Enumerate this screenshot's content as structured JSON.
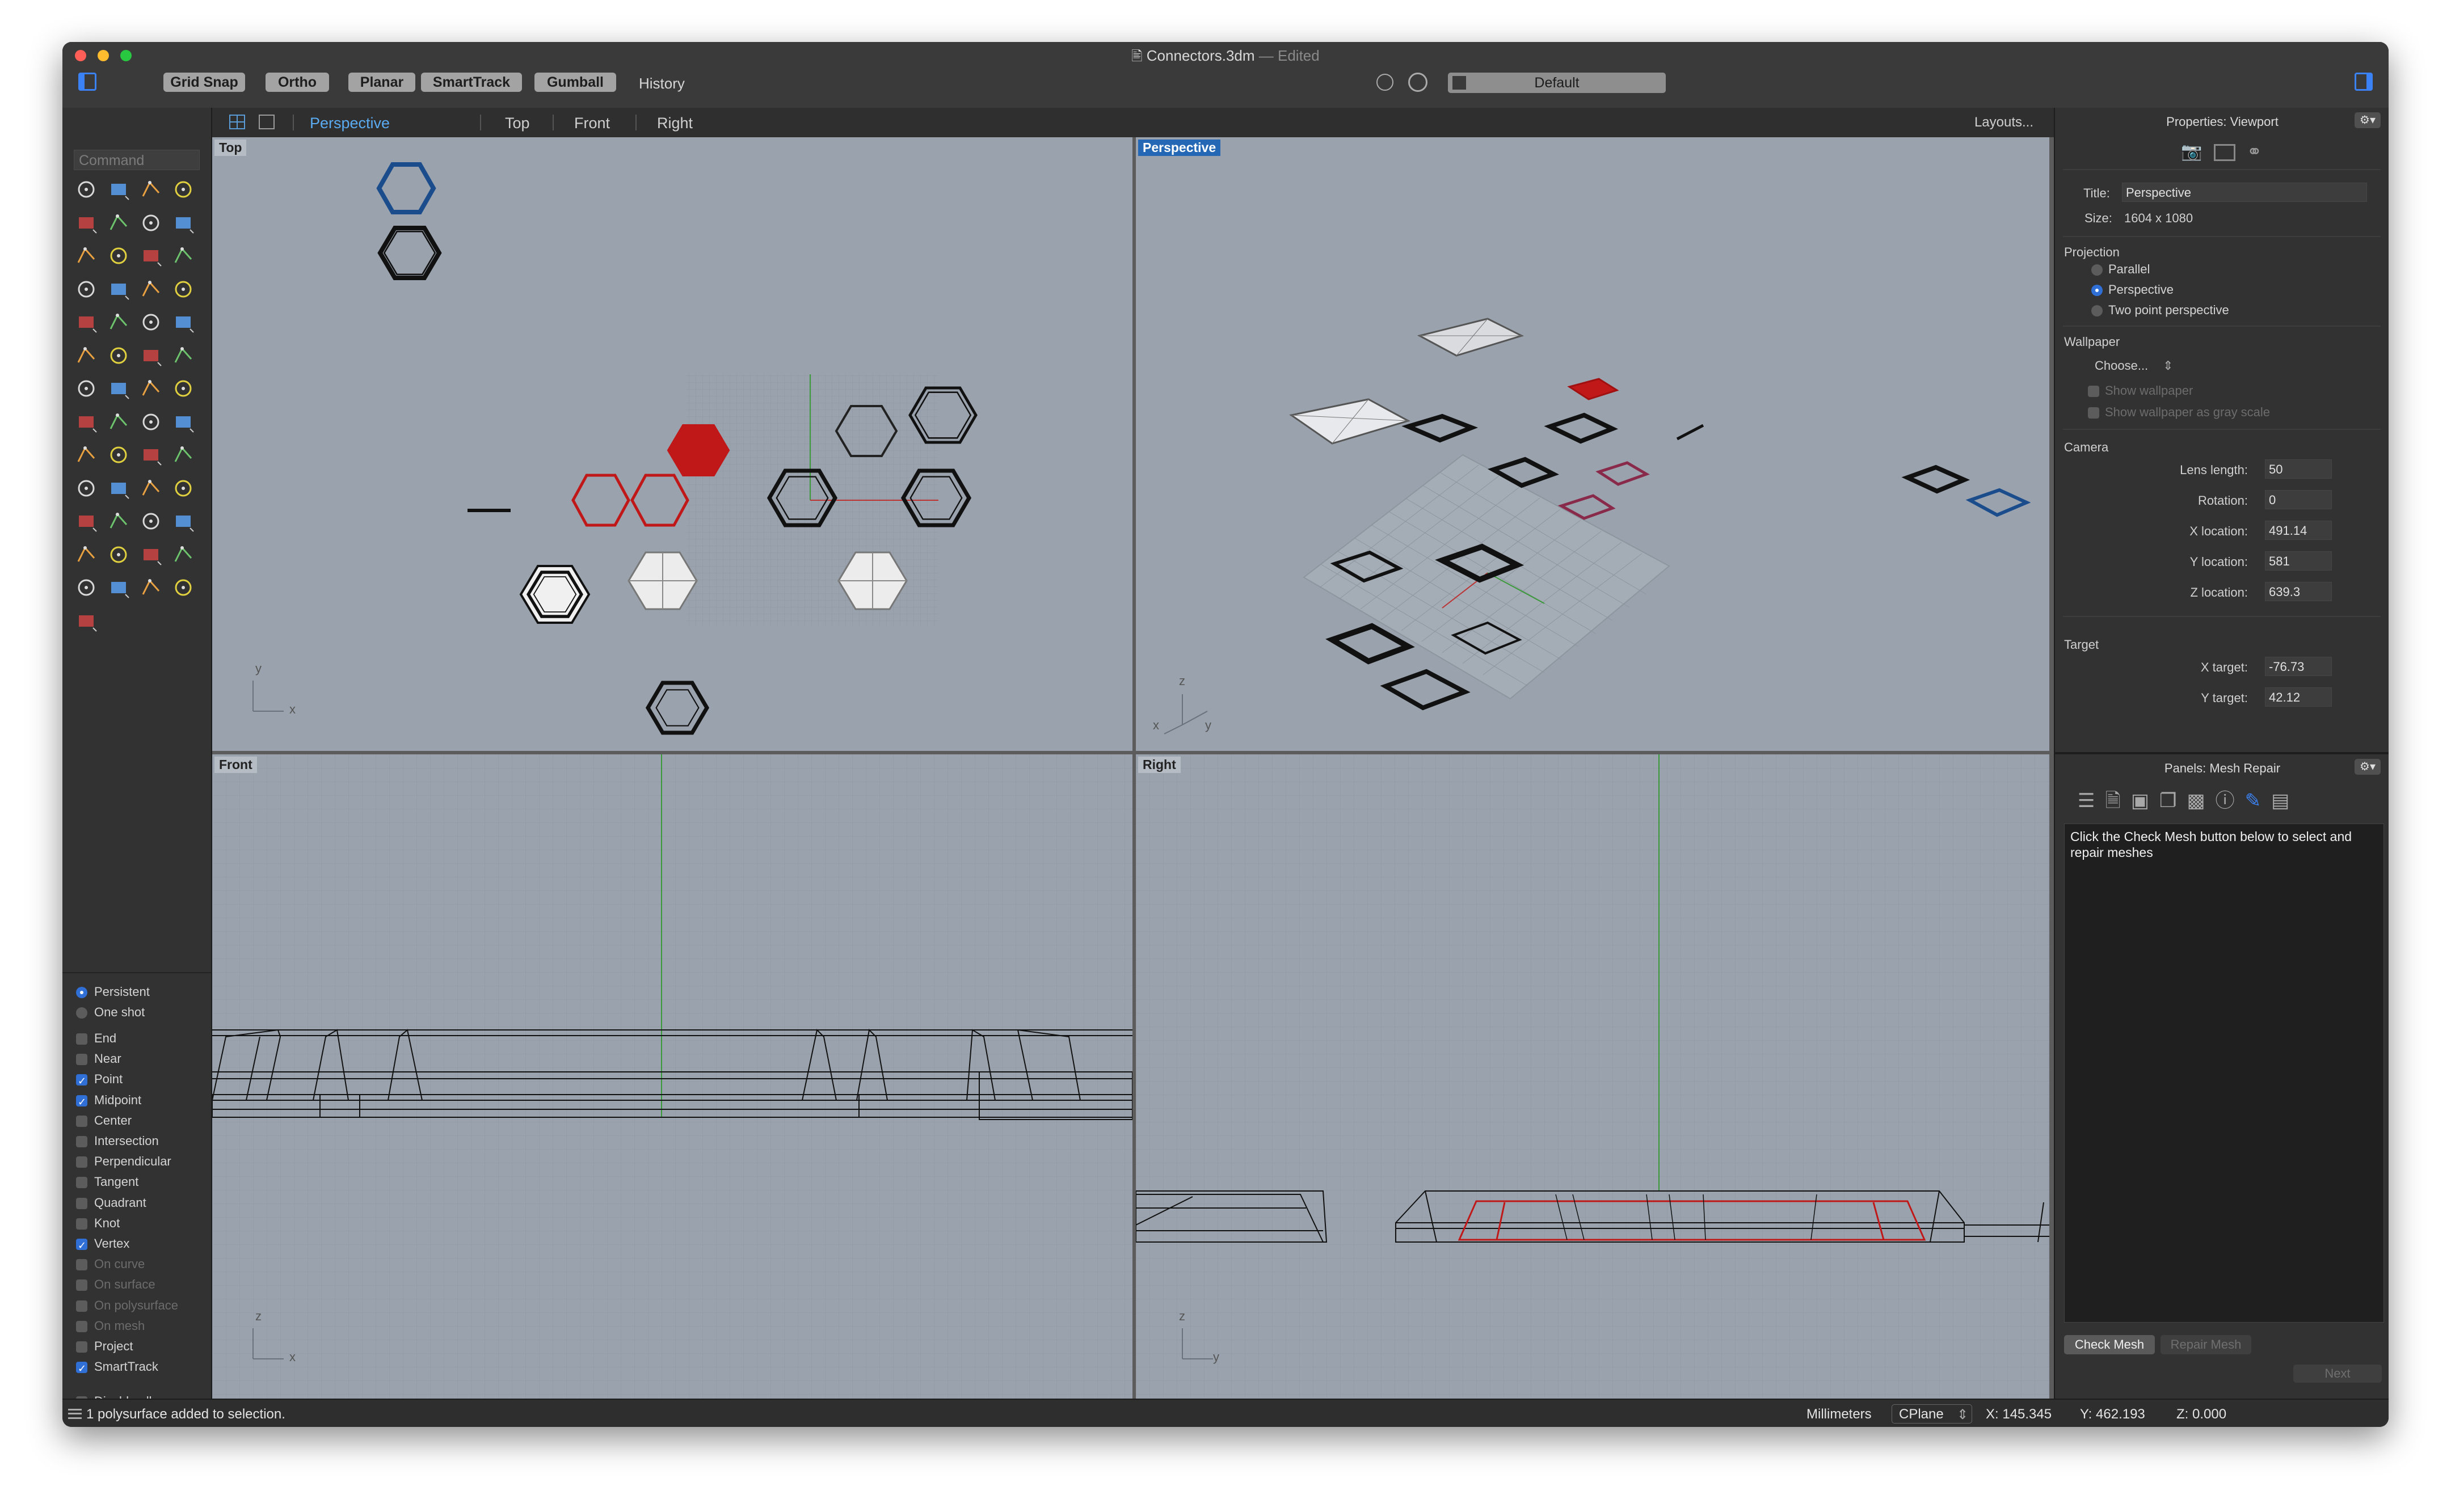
{
  "window": {
    "file_name": "Connectors.3dm",
    "edited_label": "— Edited"
  },
  "toolbar": {
    "grid_snap": "Grid Snap",
    "ortho": "Ortho",
    "planar": "Planar",
    "smarttrack": "SmartTrack",
    "gumball": "Gumball",
    "history": "History",
    "layer": "Default"
  },
  "command": {
    "placeholder": "Command"
  },
  "viewport_tabs": {
    "perspective": "Perspective",
    "top": "Top",
    "front": "Front",
    "right": "Right",
    "layouts": "Layouts..."
  },
  "viewports": {
    "top": "Top",
    "perspective": "Perspective",
    "front": "Front",
    "right": "Right",
    "axis_x": "x",
    "axis_y": "y",
    "axis_z": "z"
  },
  "osnap": {
    "persistent": "Persistent",
    "one_shot": "One shot",
    "items": [
      {
        "label": "End",
        "checked": false,
        "enabled": true
      },
      {
        "label": "Near",
        "checked": false,
        "enabled": true
      },
      {
        "label": "Point",
        "checked": true,
        "enabled": true
      },
      {
        "label": "Midpoint",
        "checked": true,
        "enabled": true
      },
      {
        "label": "Center",
        "checked": false,
        "enabled": true
      },
      {
        "label": "Intersection",
        "checked": false,
        "enabled": true
      },
      {
        "label": "Perpendicular",
        "checked": false,
        "enabled": true
      },
      {
        "label": "Tangent",
        "checked": false,
        "enabled": true
      },
      {
        "label": "Quadrant",
        "checked": false,
        "enabled": true
      },
      {
        "label": "Knot",
        "checked": false,
        "enabled": true
      },
      {
        "label": "Vertex",
        "checked": true,
        "enabled": true
      },
      {
        "label": "On curve",
        "checked": false,
        "enabled": false
      },
      {
        "label": "On surface",
        "checked": false,
        "enabled": false
      },
      {
        "label": "On polysurface",
        "checked": false,
        "enabled": false
      },
      {
        "label": "On mesh",
        "checked": false,
        "enabled": false
      },
      {
        "label": "Project",
        "checked": false,
        "enabled": true
      },
      {
        "label": "SmartTrack",
        "checked": true,
        "enabled": true
      }
    ],
    "disable_all": "Disable all"
  },
  "properties": {
    "header": "Properties: Viewport",
    "title_label": "Title:",
    "title_value": "Perspective",
    "size_label": "Size:",
    "size_value": "1604 x 1080",
    "projection_label": "Projection",
    "projection_options": [
      "Parallel",
      "Perspective",
      "Two point perspective"
    ],
    "projection_selected": "Perspective",
    "wallpaper_label": "Wallpaper",
    "wallpaper_choose": "Choose...",
    "show_wallpaper": "Show wallpaper",
    "show_gray": "Show wallpaper as gray scale",
    "camera_label": "Camera",
    "lens_label": "Lens length:",
    "lens_value": "50",
    "rotation_label": "Rotation:",
    "rotation_value": "0",
    "xloc_label": "X location:",
    "xloc_value": "491.14",
    "yloc_label": "Y location:",
    "yloc_value": "581",
    "zloc_label": "Z location:",
    "zloc_value": "639.3",
    "target_label": "Target",
    "xtarget_label": "X target:",
    "xtarget_value": "-76.73",
    "ytarget_label": "Y target:",
    "ytarget_value": "42.12"
  },
  "mesh_repair": {
    "header": "Panels: Mesh Repair",
    "message": "Click the Check Mesh button below to select and repair meshes",
    "check_mesh": "Check Mesh",
    "repair_mesh": "Repair Mesh",
    "next": "Next"
  },
  "status": {
    "message": "1 polysurface added to selection.",
    "units": "Millimeters",
    "cplane": "CPlane",
    "x": "X: 145.345",
    "y": "Y: 462.193",
    "z": "Z: 0.000"
  },
  "colors": {
    "accent_blue": "#2f6fd6",
    "selection_red": "#c01818",
    "viewport_bg": "#9aa3ad",
    "panel_bg": "#323232"
  }
}
